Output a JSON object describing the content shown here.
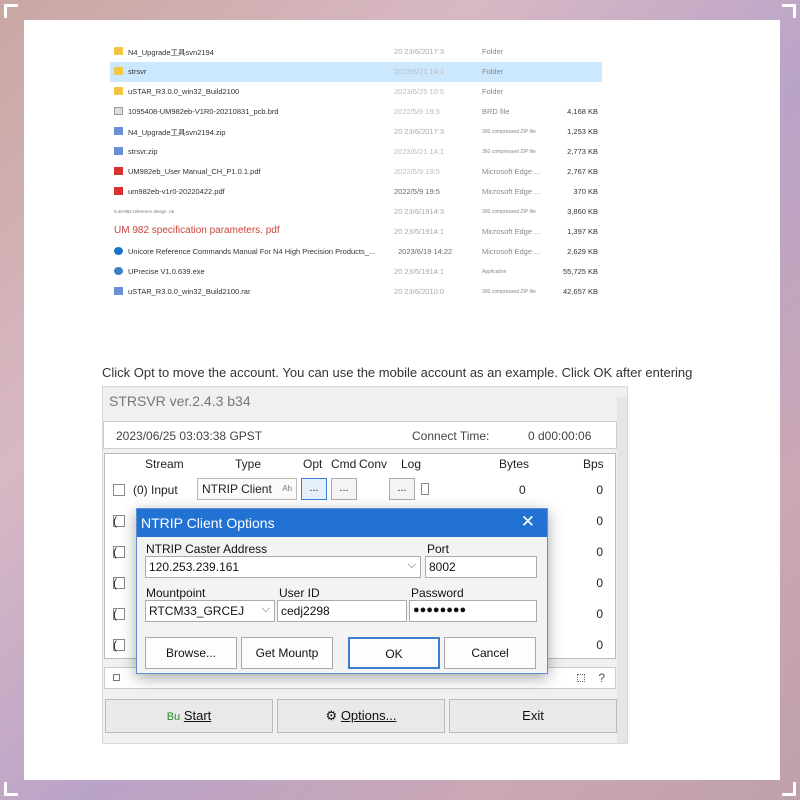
{
  "files": [
    {
      "name": "N4_Upgrade工具svn2194",
      "date": "20 23/6/2017:3",
      "type": "Folder",
      "size": "",
      "icon": "folder-icon"
    },
    {
      "name": "strsvr",
      "date": "2023/6/21 14:1",
      "type": "Folder",
      "size": "",
      "icon": "folder-icon"
    },
    {
      "name": "uSTAR_R3.0.0_win32_Build2100",
      "date": "2023/6/25 10:5",
      "type": "Folder",
      "size": "",
      "icon": "folder-icon"
    },
    {
      "name": "1095408-UM982eb-V1R0-20210831_pcb.brd",
      "date": "2022/5/9 19:5",
      "type": "BRD file",
      "size": "4,168 KB",
      "icon": "brd-file-icon"
    },
    {
      "name": "N4_Upgrade工具svn2194.zip",
      "date": "20 23/6/2017:3",
      "type": "360 compressed ZIP file",
      "size": "1,253 KB",
      "icon": "zip-icon"
    },
    {
      "name": "strsvr.zip",
      "date": "2023/6/21 14:1",
      "type": "360 compressed ZIP file",
      "size": "2,773 KB",
      "icon": "zip-icon"
    },
    {
      "name": "UM982eb_User Manual_CH_P1.0.1.pdf",
      "date": "2022/5/9 19:5",
      "type": "Microsoft Edge ...",
      "size": "2,767 KB",
      "icon": "pdf-icon"
    },
    {
      "name": "um982eb-v1r0-20220422.pdf",
      "date": "2022/5/9 19:5",
      "type": "Microsoft Edge ...",
      "size": "370 KB",
      "icon": "pdf-icon"
    },
    {
      "name": "9.40-982 reference design .rar",
      "date": "20 23/6/1914:3",
      "type": "360 compressed ZIP file",
      "size": "3,860 KB",
      "icon": ""
    },
    {
      "name": "UM 982 specification parameters. pdf",
      "date": "20 23/6/1914:1",
      "type": "Microsoft Edge ...",
      "size": "1,397 KB",
      "icon": ""
    },
    {
      "name": "Unicore Reference Commands Manual For N4 High Precision Products_...",
      "date": "2023/6/19 14:22",
      "type": "Microsoft Edge ...",
      "size": "2,629 KB",
      "icon": "pdf-icon"
    },
    {
      "name": "UPrecise V1.0.639.exe",
      "date": "20 23/6/1914:1",
      "type": "Application",
      "size": "55,725 KB",
      "icon": "exe-icon"
    },
    {
      "name": "uSTAR_R3.0.0_win32_Build2100.rar",
      "date": "20 23/6/2010:0",
      "type": "360 compressed ZIP file",
      "size": "42,657 KB",
      "icon": "zip-icon"
    }
  ],
  "instruction": "Click Opt to move the account. You can use the mobile account as an example. Click OK after entering",
  "strsvr": {
    "title": "STRSVR ver.2.4.3 b34",
    "datetime": "2023/06/25 03:03:38 GPST",
    "connect_label": "Connect Time:",
    "connect_value": "0 d00:00:06",
    "headers": {
      "stream": "Stream",
      "type": "Type",
      "opt": "Opt",
      "cmd": "Cmd",
      "conv": "Conv",
      "log": "Log",
      "bytes": "Bytes",
      "bps": "Bps"
    },
    "input_row": {
      "label": "(0) Input",
      "type": "NTRIP Client",
      "type_hint": "Ah",
      "opt": "...",
      "cmd": "...",
      "conv": "...",
      "bytes": "0",
      "bps": "0"
    },
    "output_rows": [
      {
        "label": "(",
        "bps": "0"
      },
      {
        "label": "(",
        "bps": "0"
      },
      {
        "label": "(",
        "bps": "0"
      },
      {
        "label": "(",
        "bps": "0"
      },
      {
        "label": "(",
        "bps": "0"
      }
    ],
    "help": "?",
    "start_prefix": "Bu",
    "start_label": "Start",
    "options_label": "Options...",
    "exit_label": "Exit",
    "gear_glyph": "⚙"
  },
  "dialog": {
    "title": "NTRIP Client Options",
    "close": "✕",
    "caster_label": "NTRIP Caster Address",
    "caster_value": "120.253.239.161",
    "port_label": "Port",
    "port_value": "8002",
    "mountpoint_label": "Mountpoint",
    "mountpoint_value": "RTCM33_GRCEJ",
    "userid_label": "User ID",
    "userid_value": "cedj2298",
    "password_label": "Password",
    "password_value": "●●●●●●●●",
    "browse_label": "Browse...",
    "getmount_label": "Get Mountp",
    "ok_label": "OK",
    "cancel_label": "Cancel"
  }
}
